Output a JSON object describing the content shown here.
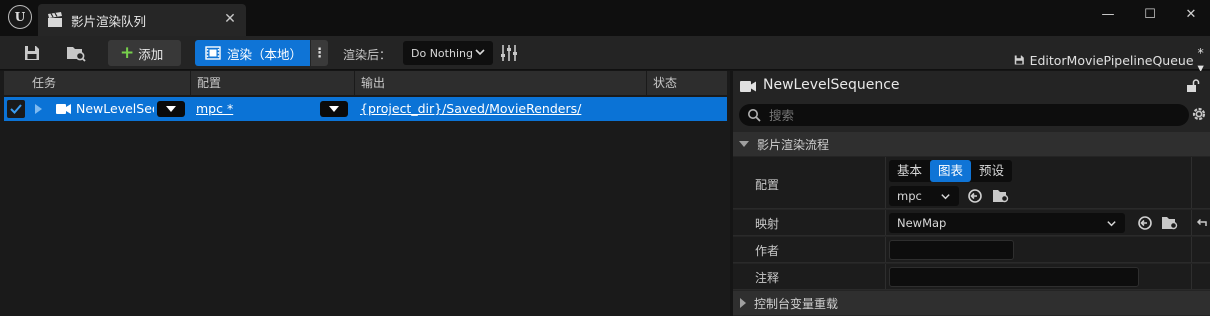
{
  "window": {
    "logo": "U",
    "tab_title": "影片渲染队列",
    "minimize": "—",
    "maximize": "☐",
    "close": "✕"
  },
  "toolbar": {
    "add_label": "添加",
    "render_label": "渲染（本地）",
    "after_render_label": "渲染后：",
    "after_render_value": "Do Nothing",
    "queue_name": "EditorMoviePipelineQueue",
    "queue_suffix": "* ▾"
  },
  "queue_table": {
    "columns": [
      "任务",
      "配置",
      "输出",
      "状态"
    ],
    "rows": [
      {
        "checked": true,
        "job_name": "NewLevelSequence",
        "config": "mpc *",
        "output": "{project_dir}/Saved/MovieRenders/",
        "status": ""
      }
    ]
  },
  "details": {
    "title": "NewLevelSequence",
    "search_placeholder": "搜索",
    "section_main": "影片渲染流程",
    "config_label": "配置",
    "config_tabs": [
      "基本",
      "图表",
      "预设"
    ],
    "config_tab_active": 1,
    "config_value": "mpc",
    "map_label": "映射",
    "map_value": "NewMap",
    "author_label": "作者",
    "author_value": "",
    "comment_label": "注释",
    "comment_value": "",
    "section_cvar": "控制台变量重载"
  },
  "colors": {
    "accent": "#0f74d6",
    "add_plus": "#77d04c"
  }
}
